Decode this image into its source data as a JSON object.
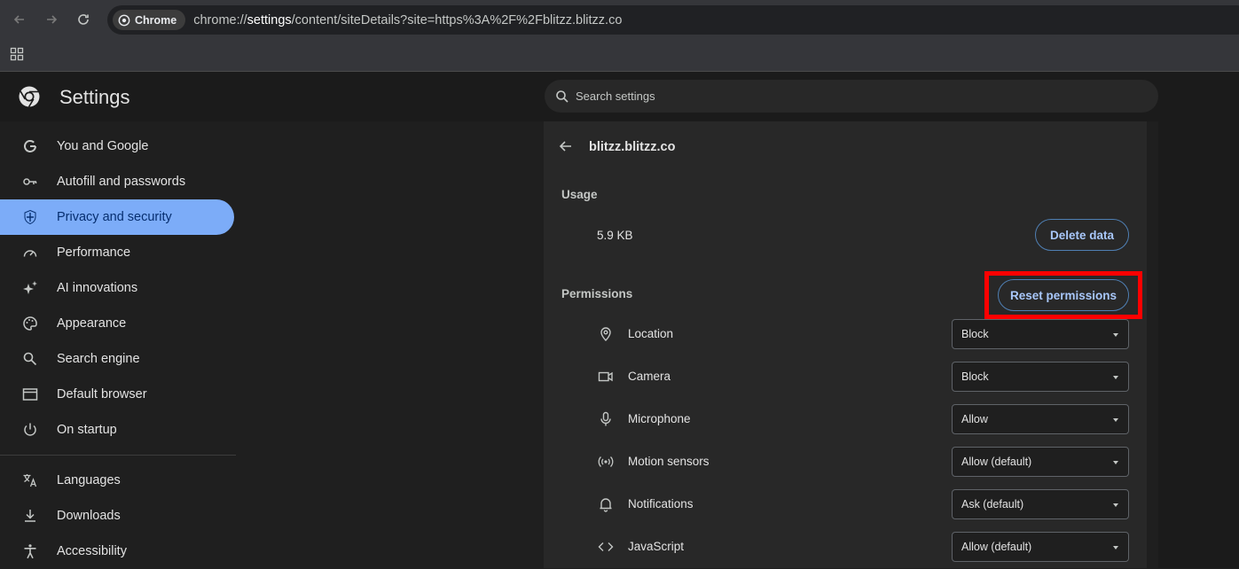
{
  "browser": {
    "chip_label": "Chrome",
    "url_prefix": "chrome://",
    "url_highlight": "settings",
    "url_rest": "/content/siteDetails?site=https%3A%2F%2Fblitzz.blitzz.co"
  },
  "header": {
    "title": "Settings",
    "search_placeholder": "Search settings"
  },
  "sidebar": {
    "items": [
      {
        "label": "You and Google",
        "icon": "google-icon"
      },
      {
        "label": "Autofill and passwords",
        "icon": "key-icon"
      },
      {
        "label": "Privacy and security",
        "icon": "shield-icon",
        "active": true
      },
      {
        "label": "Performance",
        "icon": "speedometer-icon"
      },
      {
        "label": "AI innovations",
        "icon": "sparkle-icon"
      },
      {
        "label": "Appearance",
        "icon": "palette-icon"
      },
      {
        "label": "Search engine",
        "icon": "search-icon"
      },
      {
        "label": "Default browser",
        "icon": "browser-window-icon"
      },
      {
        "label": "On startup",
        "icon": "power-icon"
      },
      {
        "label": "Languages",
        "icon": "translate-icon"
      },
      {
        "label": "Downloads",
        "icon": "download-icon"
      },
      {
        "label": "Accessibility",
        "icon": "accessibility-icon"
      }
    ]
  },
  "site": {
    "name": "blitzz.blitzz.co",
    "usage_label": "Usage",
    "usage_value": "5.9 KB",
    "delete_label": "Delete data",
    "permissions_label": "Permissions",
    "reset_label": "Reset permissions",
    "permissions": [
      {
        "label": "Location",
        "value": "Block",
        "icon": "location-pin-icon"
      },
      {
        "label": "Camera",
        "value": "Block",
        "icon": "camera-icon"
      },
      {
        "label": "Microphone",
        "value": "Allow",
        "icon": "microphone-icon"
      },
      {
        "label": "Motion sensors",
        "value": "Allow (default)",
        "icon": "motion-sensor-icon"
      },
      {
        "label": "Notifications",
        "value": "Ask (default)",
        "icon": "bell-icon"
      },
      {
        "label": "JavaScript",
        "value": "Allow (default)",
        "icon": "code-icon"
      }
    ]
  },
  "colors": {
    "accent": "#7cacf8",
    "highlight_box": "#ff0000"
  }
}
